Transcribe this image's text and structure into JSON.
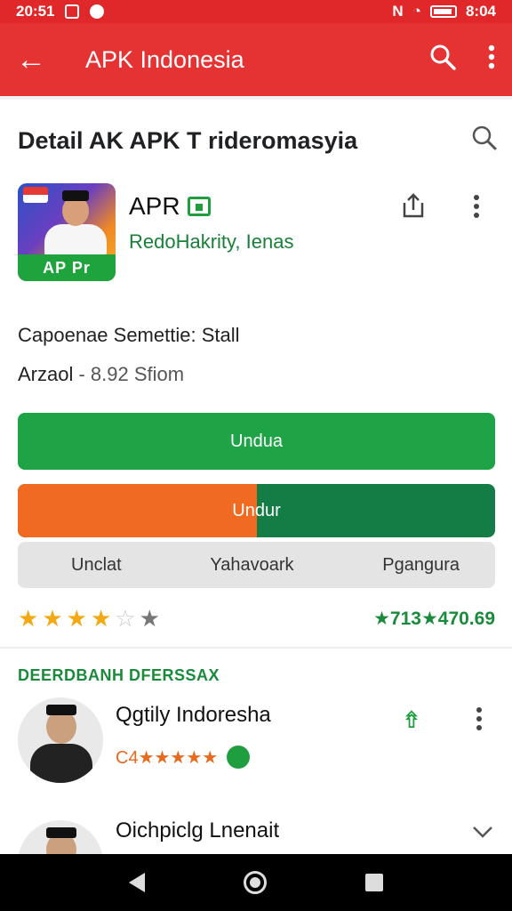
{
  "status_bar": {
    "time": "20:51",
    "right_text": "8:04"
  },
  "app_bar": {
    "title": "APK Indonesia"
  },
  "header": {
    "title": "Detail AK APK T rideromasyia"
  },
  "app": {
    "icon_label": "AP Pr",
    "name": "APR",
    "developer": "RedoHakrity, Ienas",
    "category": "Capoenae Semettie: Stall",
    "size_label": "Arzaol",
    "size_value": "- 8.92 Sfiom"
  },
  "buttons": {
    "download_label": "Undua",
    "progress_label": "Undur",
    "progress_fraction": 0.5
  },
  "tabs": [
    "Unclat",
    "Yahavoark",
    "Pgangura"
  ],
  "rating": {
    "stars": 4,
    "count_text": "★713★470.69"
  },
  "section": {
    "title": "DEERDBANH DFERSSAX"
  },
  "list": [
    {
      "title": "Qgtily Indoresha",
      "subtitle": "C4★★★★★"
    },
    {
      "title": "Oichpiclg Lnenait"
    }
  ],
  "colors": {
    "primary": "#e53333",
    "green": "#1ea346",
    "orange": "#f06a22"
  }
}
